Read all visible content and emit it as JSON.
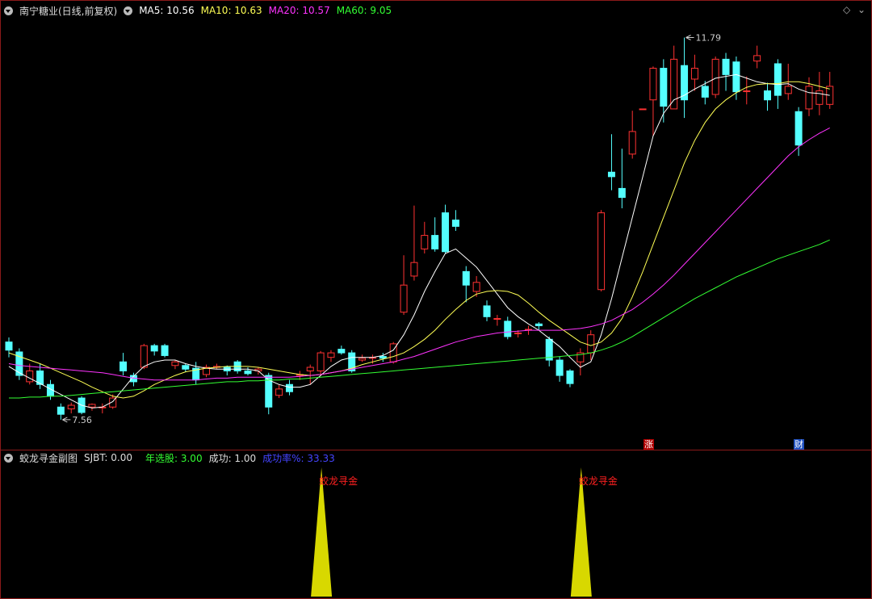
{
  "main_header": {
    "stock_title": "南宁糖业(日线,前复权)",
    "ma5_label": "MA5: 10.56",
    "ma10_label": "MA10: 10.63",
    "ma20_label": "MA20: 10.57",
    "ma60_label": "MA60: 9.05"
  },
  "sub_header": {
    "indicator_name": "蛟龙寻金副图",
    "sjbt_label": "SJBT: 0.00",
    "annual_label": "年选股: 3.00",
    "success_label": "成功: 1.00",
    "rate_label": "成功率%: 33.33"
  },
  "badges": {
    "rise": "涨",
    "finance": "财"
  },
  "colors": {
    "up": "#ff3232",
    "down": "#54ffff",
    "ma5": "#ffffff",
    "ma10": "#ffff55",
    "ma20": "#ff33ff",
    "ma60": "#33ff33",
    "signal": "#d8d800",
    "signal_label": "#ff2020",
    "rate": "#4444ff",
    "annual": "#33ff33"
  },
  "chart_data": [
    {
      "type": "candlestick",
      "title": "南宁糖业(日线,前复权)",
      "ylim": [
        7.3,
        12.0
      ],
      "annotations": [
        {
          "text": "11.79",
          "kind": "high"
        },
        {
          "text": "7.56",
          "kind": "low"
        }
      ],
      "candles": [
        [
          8.42,
          8.33,
          8.47,
          8.25
        ],
        [
          8.31,
          8.05,
          8.35,
          8.0
        ],
        [
          7.98,
          8.1,
          8.18,
          7.95
        ],
        [
          8.1,
          7.95,
          8.18,
          7.9
        ],
        [
          7.95,
          7.82,
          8.0,
          7.78
        ],
        [
          7.7,
          7.62,
          7.74,
          7.56
        ],
        [
          7.68,
          7.72,
          7.75,
          7.63
        ],
        [
          7.8,
          7.64,
          7.82,
          7.62
        ],
        [
          7.7,
          7.73,
          7.74,
          7.66
        ],
        [
          7.7,
          7.7,
          7.74,
          7.63
        ],
        [
          7.7,
          7.8,
          7.84,
          7.68
        ],
        [
          8.2,
          8.1,
          8.3,
          8.05
        ],
        [
          8.05,
          7.98,
          8.08,
          7.93
        ],
        [
          8.14,
          8.38,
          8.4,
          8.12
        ],
        [
          8.38,
          8.32,
          8.4,
          8.27
        ],
        [
          8.38,
          8.27,
          8.4,
          8.25
        ],
        [
          8.16,
          8.2,
          8.22,
          8.12
        ],
        [
          8.16,
          8.12,
          8.18,
          8.09
        ],
        [
          8.13,
          8.0,
          8.2,
          7.95
        ],
        [
          8.06,
          8.14,
          8.17,
          8.03
        ],
        [
          8.14,
          8.15,
          8.18,
          8.12
        ],
        [
          8.14,
          8.1,
          8.16,
          8.05
        ],
        [
          8.2,
          8.1,
          8.22,
          8.07
        ],
        [
          8.1,
          8.07,
          8.14,
          8.05
        ],
        [
          8.1,
          8.12,
          8.14,
          8.06
        ],
        [
          8.05,
          7.7,
          8.08,
          7.62
        ],
        [
          7.83,
          7.9,
          7.95,
          7.8
        ],
        [
          7.95,
          7.87,
          8.0,
          7.83
        ],
        [
          8.05,
          8.06,
          8.1,
          8.0
        ],
        [
          8.1,
          8.14,
          8.17,
          7.95
        ],
        [
          8.1,
          8.3,
          8.32,
          8.05
        ],
        [
          8.25,
          8.3,
          8.33,
          8.2
        ],
        [
          8.34,
          8.3,
          8.38,
          8.28
        ],
        [
          8.3,
          8.1,
          8.33,
          8.08
        ],
        [
          8.22,
          8.24,
          8.28,
          8.2
        ],
        [
          8.24,
          8.25,
          8.28,
          8.18
        ],
        [
          8.26,
          8.24,
          8.3,
          8.2
        ],
        [
          8.2,
          8.4,
          8.42,
          8.18
        ],
        [
          8.75,
          9.05,
          9.38,
          8.72
        ],
        [
          9.15,
          9.3,
          9.93,
          9.1
        ],
        [
          9.45,
          9.6,
          9.75,
          9.4
        ],
        [
          9.6,
          9.45,
          9.8,
          9.42
        ],
        [
          9.85,
          9.42,
          9.94,
          9.4
        ],
        [
          9.77,
          9.7,
          9.88,
          9.65
        ],
        [
          9.2,
          9.05,
          9.26,
          8.86
        ],
        [
          8.98,
          9.08,
          9.15,
          8.92
        ],
        [
          8.82,
          8.7,
          8.88,
          8.65
        ],
        [
          8.68,
          8.68,
          8.72,
          8.6
        ],
        [
          8.65,
          8.48,
          8.7,
          8.45
        ],
        [
          8.52,
          8.52,
          8.55,
          8.47
        ],
        [
          8.56,
          8.56,
          8.6,
          8.5
        ],
        [
          8.62,
          8.6,
          8.64,
          8.55
        ],
        [
          8.45,
          8.22,
          8.48,
          8.15
        ],
        [
          8.22,
          8.05,
          8.26,
          7.98
        ],
        [
          8.1,
          7.96,
          8.12,
          7.92
        ],
        [
          8.2,
          8.3,
          8.35,
          8.05
        ],
        [
          8.3,
          8.5,
          8.55,
          8.22
        ],
        [
          9.0,
          9.85,
          9.88,
          8.98
        ],
        [
          10.3,
          10.25,
          10.72,
          10.1
        ],
        [
          10.12,
          10.02,
          10.56,
          9.9
        ],
        [
          10.5,
          10.75,
          10.98,
          10.45
        ],
        [
          11.0,
          11.0,
          11.0,
          11.0
        ],
        [
          11.1,
          11.45,
          11.47,
          10.7
        ],
        [
          11.45,
          11.03,
          11.55,
          10.85
        ],
        [
          11.0,
          11.55,
          11.7,
          11.0
        ],
        [
          11.48,
          11.1,
          11.79,
          10.9
        ],
        [
          11.33,
          11.45,
          11.6,
          11.2
        ],
        [
          11.25,
          11.13,
          11.31,
          11.05
        ],
        [
          11.16,
          11.55,
          11.58,
          11.12
        ],
        [
          11.55,
          11.38,
          11.62,
          11.2
        ],
        [
          11.52,
          11.19,
          11.58,
          11.1
        ],
        [
          11.2,
          11.2,
          11.36,
          11.05
        ],
        [
          11.53,
          11.59,
          11.7,
          11.45
        ],
        [
          11.2,
          11.1,
          11.29,
          10.98
        ],
        [
          11.5,
          11.15,
          11.55,
          11.0
        ],
        [
          11.17,
          11.25,
          11.5,
          11.1
        ],
        [
          10.97,
          10.6,
          11.02,
          10.48
        ],
        [
          11.0,
          11.25,
          11.35,
          10.92
        ],
        [
          11.05,
          11.2,
          11.41,
          10.93
        ],
        [
          11.05,
          11.25,
          11.41,
          11.0
        ]
      ],
      "series": [
        {
          "name": "MA5",
          "values": [
            8.15,
            8.08,
            8.02,
            7.96,
            7.9,
            7.84,
            7.78,
            7.72,
            7.69,
            7.7,
            7.76,
            7.9,
            8.04,
            8.15,
            8.2,
            8.22,
            8.22,
            8.18,
            8.15,
            8.13,
            8.12,
            8.12,
            8.12,
            8.12,
            8.1,
            8.0,
            7.95,
            7.92,
            7.92,
            7.95,
            8.05,
            8.15,
            8.22,
            8.25,
            8.25,
            8.25,
            8.27,
            8.33,
            8.5,
            8.72,
            8.98,
            9.2,
            9.4,
            9.45,
            9.35,
            9.25,
            9.1,
            8.95,
            8.8,
            8.7,
            8.62,
            8.55,
            8.46,
            8.37,
            8.25,
            8.14,
            8.2,
            8.5,
            8.9,
            9.35,
            9.8,
            10.25,
            10.7,
            10.95,
            11.1,
            11.15,
            11.22,
            11.28,
            11.34,
            11.36,
            11.38,
            11.34,
            11.3,
            11.28,
            11.27,
            11.28,
            11.22,
            11.18,
            11.17,
            11.15
          ]
        },
        {
          "name": "MA10",
          "values": [
            8.3,
            8.26,
            8.22,
            8.18,
            8.13,
            8.08,
            8.03,
            7.98,
            7.92,
            7.87,
            7.82,
            7.8,
            7.82,
            7.88,
            7.95,
            8.0,
            8.05,
            8.09,
            8.11,
            8.13,
            8.14,
            8.15,
            8.15,
            8.15,
            8.14,
            8.12,
            8.1,
            8.08,
            8.06,
            8.05,
            8.06,
            8.08,
            8.1,
            8.13,
            8.17,
            8.2,
            8.23,
            8.26,
            8.3,
            8.37,
            8.45,
            8.55,
            8.67,
            8.78,
            8.88,
            8.95,
            8.98,
            8.99,
            8.98,
            8.94,
            8.85,
            8.75,
            8.66,
            8.58,
            8.5,
            8.42,
            8.38,
            8.42,
            8.52,
            8.68,
            8.92,
            9.2,
            9.5,
            9.8,
            10.1,
            10.4,
            10.65,
            10.85,
            11.0,
            11.1,
            11.18,
            11.24,
            11.27,
            11.28,
            11.28,
            11.3,
            11.3,
            11.28,
            11.25,
            11.22
          ]
        },
        {
          "name": "MA20",
          "values": [
            8.18,
            8.16,
            8.15,
            8.14,
            8.13,
            8.12,
            8.11,
            8.1,
            8.09,
            8.08,
            8.06,
            8.04,
            8.02,
            8.01,
            8.0,
            8.0,
            8.0,
            8.0,
            8.0,
            8.01,
            8.02,
            8.02,
            8.03,
            8.03,
            8.03,
            8.03,
            8.03,
            8.03,
            8.04,
            8.05,
            8.06,
            8.08,
            8.1,
            8.12,
            8.14,
            8.16,
            8.18,
            8.2,
            8.23,
            8.26,
            8.3,
            8.34,
            8.38,
            8.42,
            8.45,
            8.48,
            8.5,
            8.52,
            8.53,
            8.54,
            8.55,
            8.55,
            8.55,
            8.55,
            8.56,
            8.57,
            8.59,
            8.62,
            8.66,
            8.72,
            8.78,
            8.86,
            8.95,
            9.05,
            9.16,
            9.28,
            9.4,
            9.52,
            9.64,
            9.76,
            9.88,
            10.0,
            10.12,
            10.24,
            10.36,
            10.48,
            10.58,
            10.66,
            10.73,
            10.79
          ]
        },
        {
          "name": "MA60",
          "values": [
            7.8,
            7.8,
            7.81,
            7.81,
            7.82,
            7.82,
            7.83,
            7.84,
            7.85,
            7.86,
            7.87,
            7.88,
            7.89,
            7.9,
            7.91,
            7.92,
            7.93,
            7.94,
            7.95,
            7.96,
            7.97,
            7.98,
            7.98,
            7.99,
            7.99,
            8.0,
            8.0,
            8.01,
            8.01,
            8.02,
            8.03,
            8.04,
            8.05,
            8.06,
            8.07,
            8.08,
            8.09,
            8.1,
            8.11,
            8.12,
            8.13,
            8.14,
            8.15,
            8.16,
            8.17,
            8.18,
            8.19,
            8.2,
            8.21,
            8.22,
            8.23,
            8.24,
            8.25,
            8.26,
            8.27,
            8.28,
            8.3,
            8.33,
            8.37,
            8.42,
            8.48,
            8.55,
            8.62,
            8.69,
            8.76,
            8.83,
            8.9,
            8.96,
            9.02,
            9.08,
            9.14,
            9.19,
            9.24,
            9.29,
            9.34,
            9.38,
            9.42,
            9.46,
            9.5,
            9.55
          ]
        }
      ]
    },
    {
      "type": "signal",
      "title": "蛟龙寻金副图",
      "signals": [
        {
          "index": 30,
          "label": "蛟龙寻金"
        },
        {
          "index": 55,
          "label": "蛟龙寻金"
        }
      ]
    }
  ]
}
